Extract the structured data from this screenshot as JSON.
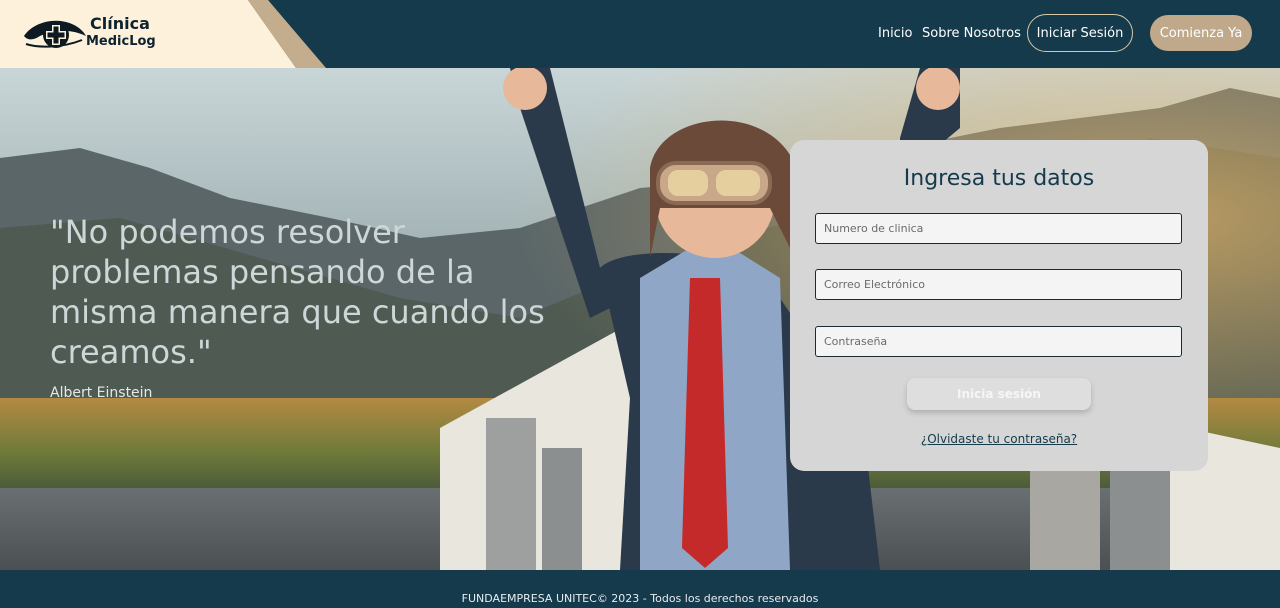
{
  "header": {
    "brand_line1": "Clínica",
    "brand_line2": "MedicLog",
    "nav": {
      "home": "Inicio",
      "about": "Sobre Nosotros",
      "login": "Iniciar Sesión",
      "start": "Comienza Ya"
    }
  },
  "hero": {
    "quote": "\"No podemos resolver problemas pensando de la misma manera que cuando los creamos.\"",
    "author": "Albert Einstein"
  },
  "login_card": {
    "title": "Ingresa tus datos",
    "clinic_placeholder": "Numero de clinica",
    "email_placeholder": "Correo Electrónico",
    "password_placeholder": "Contraseña",
    "submit_label": "Inicia sesión",
    "forgot_label": "¿Olvidaste tu contraseña?"
  },
  "footer": {
    "text": "FUNDAEMPRESA UNITEC© 2023 - Todos los derechos reservados"
  },
  "colors": {
    "primary": "#143a4c",
    "accent": "#bfa98a",
    "cream": "#fdf1dc"
  }
}
